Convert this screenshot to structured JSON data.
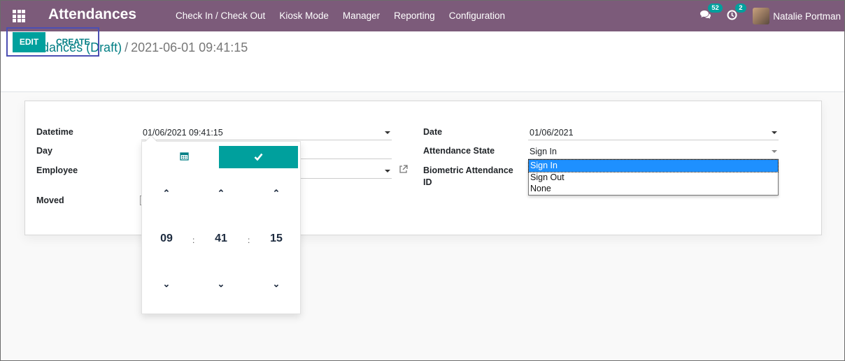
{
  "navbar": {
    "app_title": "Attendances",
    "menu": [
      "Check In / Check Out",
      "Kiosk Mode",
      "Manager",
      "Reporting",
      "Configuration"
    ],
    "messages_badge": "52",
    "activities_badge": "2",
    "user_name": "Natalie Portman"
  },
  "breadcrumb": {
    "parent": "Attendances (Draft)",
    "separator": "/",
    "current": "2021-06-01 09:41:15"
  },
  "buttons": {
    "edit": "EDIT",
    "create": "CREATE"
  },
  "form": {
    "datetime_label": "Datetime",
    "datetime_value": "01/06/2021 09:41:15",
    "day_label": "Day",
    "employee_label": "Employee",
    "moved_label": "Moved",
    "date_label": "Date",
    "date_value": "01/06/2021",
    "state_label": "Attendance State",
    "state_value": "Sign In",
    "biometric_label_1": "Biometric Attendance",
    "biometric_label_2": "ID"
  },
  "picker": {
    "hours": "09",
    "minutes": "41",
    "seconds": "15",
    "separator": ":"
  },
  "state_options": [
    "Sign In",
    "Sign Out",
    "None"
  ],
  "colors": {
    "navbar": "#7c5b7a",
    "primary": "#00a09d",
    "link": "#017e84",
    "highlight": "#1e90ff"
  }
}
